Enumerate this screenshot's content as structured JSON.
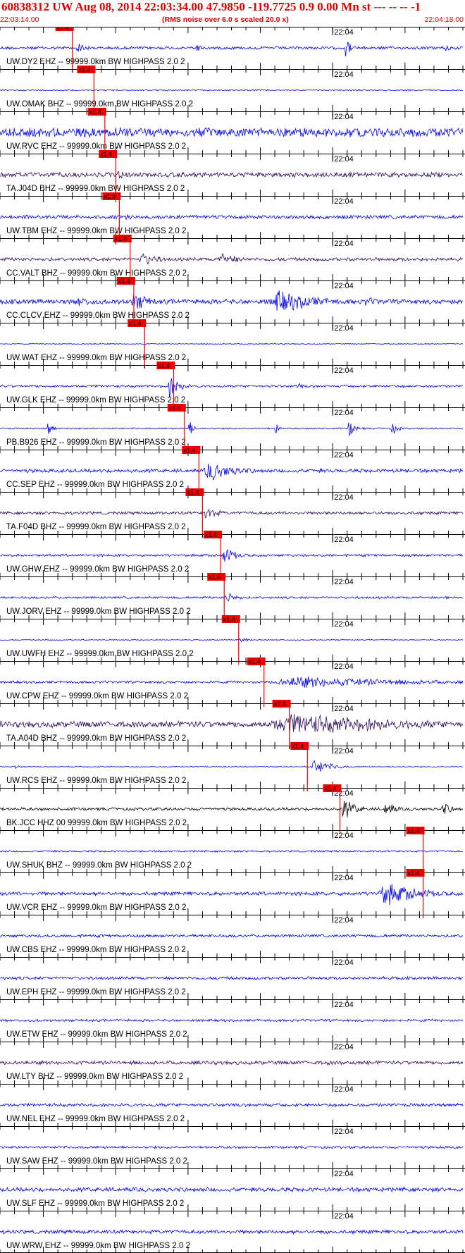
{
  "header": {
    "title": "60838312 UW Aug 08, 2014 22:03:34.00   47.9850 -119.7725  0.9 0.00 Mn st --- -- --   -1",
    "start_time": "22:03:14.00",
    "noise_note": "(RMS noise over 6.0 s scaled 20.0 x)",
    "end_time": "22:04:18.00"
  },
  "colors": {
    "header_text": "#e00000",
    "trace_default": "#0000ee",
    "trace_dark": "#2a0a5c",
    "trace_black": "#000000",
    "pick_marker": "#ff0000",
    "pick_label_bg": "#ee0000",
    "axis": "#000000"
  },
  "chart_data": {
    "type": "line",
    "x_unit": "seconds after 22:03:14.00",
    "xlim": [
      0,
      64
    ],
    "minute_marker": {
      "label": "22:04",
      "time": 46
    },
    "tick_interval_s": 2,
    "filter": "HIGHPASS  2.0  2",
    "pick_label": "x1.4",
    "traces": [
      {
        "label": "UW.DY2 EHZ -- 99999.0km BW  HIGHPASS  2.0  2",
        "pick": 10.0,
        "color": "blue",
        "amp": 0.12,
        "bursts": [
          [
            10.5,
            2,
            0.5
          ],
          [
            27,
            1,
            0.5
          ],
          [
            47.5,
            1.5,
            0.8
          ],
          [
            61.5,
            1,
            0.5
          ]
        ]
      },
      {
        "label": "UW.OMAK BHZ -- 99999.0km BW  HIGHPASS  2.0  2",
        "pick": 13.0,
        "color": "blue",
        "amp": 0.05,
        "bursts": []
      },
      {
        "label": "UW.RVC EHZ -- 99999.0km BW  HIGHPASS  2.0  2",
        "pick": 14.5,
        "color": "blue",
        "amp": 0.38,
        "bursts": [
          [
            15,
            6,
            0.7
          ]
        ]
      },
      {
        "label": "TA.J04D BHZ -- 99999.0km BW  HIGHPASS  2.0  2",
        "pick": 16.0,
        "color": "dark",
        "amp": 0.2,
        "bursts": [
          [
            16,
            3,
            0.4
          ],
          [
            40,
            2,
            0.3
          ]
        ]
      },
      {
        "label": "UW.TBM EHZ -- 99999.0km BW  HIGHPASS  2.0  2",
        "pick": 16.5,
        "color": "blue",
        "amp": 0.15,
        "bursts": [
          [
            17,
            3,
            0.3
          ]
        ]
      },
      {
        "label": "CC.VALT BHZ -- 99999.0km BW  HIGHPASS  2.0  2",
        "pick": 18.0,
        "color": "dark",
        "amp": 0.14,
        "bursts": [
          [
            19,
            4,
            0.6
          ],
          [
            30,
            4,
            0.6
          ]
        ]
      },
      {
        "label": "CC.CLCV EHZ -- 99999.0km BW  HIGHPASS  2.0  2",
        "pick": 18.5,
        "color": "blue",
        "amp": 0.2,
        "bursts": [
          [
            10,
            5,
            0.5
          ],
          [
            18,
            4,
            0.8
          ],
          [
            37,
            9,
            1.0
          ],
          [
            50,
            4,
            0.4
          ]
        ]
      },
      {
        "label": "UW.WAT EHZ -- 99999.0km BW  HIGHPASS  2.0  2",
        "pick": 20.0,
        "color": "blue",
        "amp": 0.04,
        "bursts": []
      },
      {
        "label": "UW.GLK EHZ -- 99999.0km BW  HIGHPASS  2.0  2",
        "pick": 24.0,
        "color": "blue",
        "amp": 0.1,
        "bursts": [
          [
            23,
            2.5,
            0.9
          ],
          [
            41,
            1.5,
            0.3
          ]
        ]
      },
      {
        "label": "PB.B926 EHZ -- 99999.0km BW  HIGHPASS  2.0  2",
        "pick": 25.5,
        "color": "blue",
        "amp": 0.06,
        "bursts": [
          [
            6.5,
            1,
            0.7
          ],
          [
            26,
            1,
            0.7
          ],
          [
            38,
            0.6,
            0.9
          ],
          [
            48,
            1.5,
            0.8
          ],
          [
            54,
            1.5,
            0.5
          ]
        ]
      },
      {
        "label": "CC.SEP EHZ -- 99999.0km BW  HIGHPASS  2.0  2",
        "pick": 27.5,
        "color": "blue",
        "amp": 0.15,
        "bursts": [
          [
            28,
            6,
            0.9
          ]
        ]
      },
      {
        "label": "TA.F04D BHZ -- 99999.0km BW  HIGHPASS  2.0  2",
        "pick": 28.0,
        "color": "dark",
        "amp": 0.12,
        "bursts": [
          [
            28,
            3,
            0.6
          ]
        ]
      },
      {
        "label": "UW.GHW EHZ -- 99999.0km BW  HIGHPASS  2.0  2",
        "pick": 30.5,
        "color": "blue",
        "amp": 0.1,
        "bursts": [
          [
            30.5,
            3,
            0.7
          ]
        ]
      },
      {
        "label": "UW.JORV EHZ -- 99999.0km BW  HIGHPASS  2.0  2",
        "pick": 31.0,
        "color": "blue",
        "amp": 0.09,
        "bursts": [
          [
            31,
            2.5,
            0.5
          ],
          [
            61.5,
            0.8,
            0.3
          ]
        ]
      },
      {
        "label": "UW.UWFH EHZ -- 99999.0km BW  HIGHPASS  2.0  2",
        "pick": 33.0,
        "color": "blue",
        "amp": 0.04,
        "bursts": [
          [
            33,
            2,
            0.25
          ]
        ]
      },
      {
        "label": "UW.CPW EHZ -- 99999.0km BW  HIGHPASS  2.0  2",
        "pick": 36.5,
        "color": "blue",
        "amp": 0.1,
        "bursts": [
          [
            37,
            27,
            0.5
          ]
        ]
      },
      {
        "label": "TA.A04D BHZ -- 99999.0km BW  HIGHPASS  2.0  2",
        "pick": 40.0,
        "color": "dark",
        "amp": 0.25,
        "bursts": [
          [
            36,
            28,
            0.95
          ]
        ]
      },
      {
        "label": "UW.RCS EHZ -- 99999.0km BW  HIGHPASS  2.0  2",
        "pick": 42.5,
        "color": "blue",
        "amp": 0.04,
        "bursts": [
          [
            43,
            3,
            0.8
          ],
          [
            2,
            1,
            0.2
          ]
        ]
      },
      {
        "label": "BK.JCC HHZ 00 99999.0km BW  HIGHPASS  2.0  2",
        "pick": 47.0,
        "color": "black",
        "amp": 0.12,
        "bursts": [
          [
            47,
            3,
            0.9
          ],
          [
            53,
            2,
            0.8
          ],
          [
            61,
            2,
            0.6
          ]
        ]
      },
      {
        "label": "UW.SHUK BHZ -- 99999.0km BW  HIGHPASS  2.0  2",
        "pick": 58.5,
        "color": "blue",
        "amp": 0.07,
        "bursts": []
      },
      {
        "label": "UW.VCR EHZ -- 99999.0km BW  HIGHPASS  2.0  2",
        "pick": 58.5,
        "color": "blue",
        "amp": 0.15,
        "bursts": [
          [
            52,
            8,
            1.0
          ]
        ]
      },
      {
        "label": "UW.CBS EHZ -- 99999.0km BW  HIGHPASS  2.0  2",
        "pick": null,
        "color": "blue",
        "amp": 0.12,
        "bursts": []
      },
      {
        "label": "UW.EPH EHZ -- 99999.0km BW  HIGHPASS  2.0  2",
        "pick": null,
        "color": "blue",
        "amp": 0.12,
        "bursts": []
      },
      {
        "label": "UW.ETW EHZ -- 99999.0km BW  HIGHPASS  2.0  2",
        "pick": null,
        "color": "blue",
        "amp": 0.1,
        "bursts": []
      },
      {
        "label": "UW.LTY BHZ -- 99999.0km BW  HIGHPASS  2.0  2",
        "pick": null,
        "color": "dark",
        "amp": 0.15,
        "bursts": [
          [
            45,
            1,
            0.35
          ]
        ]
      },
      {
        "label": "UW.NEL EHZ -- 99999.0km BW  HIGHPASS  2.0  2",
        "pick": null,
        "color": "blue",
        "amp": 0.13,
        "bursts": []
      },
      {
        "label": "UW.SAW EHZ -- 99999.0km BW  HIGHPASS  2.0  2",
        "pick": null,
        "color": "blue",
        "amp": 0.1,
        "bursts": []
      },
      {
        "label": "UW.SLF EHZ -- 99999.0km BW  HIGHPASS  2.0  2",
        "pick": null,
        "color": "blue",
        "amp": 0.17,
        "bursts": []
      },
      {
        "label": "UW.WRW EHZ -- 99999.0km BW  HIGHPASS  2.0  2",
        "pick": null,
        "color": "blue",
        "amp": 0.15,
        "bursts": []
      }
    ]
  }
}
